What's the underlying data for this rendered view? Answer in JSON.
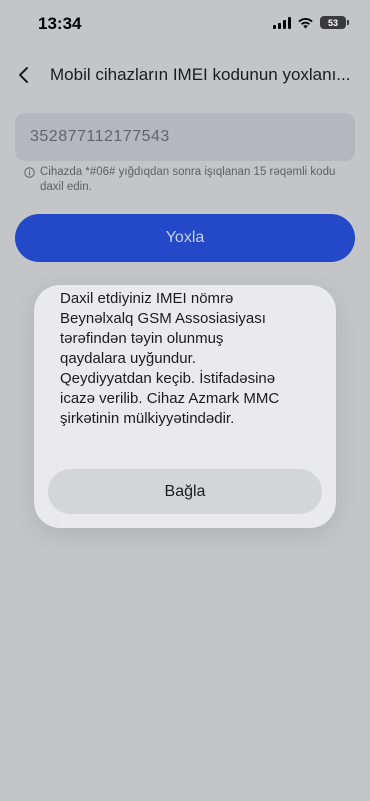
{
  "status_bar": {
    "time": "13:34",
    "battery": "53",
    "icons": [
      "signal-icon",
      "wifi-icon",
      "battery-icon"
    ]
  },
  "header": {
    "title": "Mobil cihazların IMEI kodunun yoxlanı...",
    "back_icon": "chevron-left-icon"
  },
  "form": {
    "imei_value": "352877112177543",
    "hint_icon": "info-icon",
    "hint": "Cihazda *#06# yığdıqdan sonra işıqlanan 15 rəqəmli kodu daxil edin.",
    "check_button": "Yoxla"
  },
  "dialog": {
    "message_lines": [
      "Daxil etdiyiniz IMEI nömrə",
      "Beynəlxalq GSM Assosiasiyası",
      "tərəfindən təyin olunmuş",
      "qaydalara uyğundur.",
      "Qeydiyyatdan keçib.  İstifadəsinə",
      "icazə verilib. Cihaz Azmark MMC",
      "şirkətinin mülkiyyətindədir."
    ],
    "close_button": "Bağla"
  },
  "colors": {
    "background": "#c3c5c9",
    "primary_button": "#2348c8",
    "dialog": "#eaeaee"
  }
}
